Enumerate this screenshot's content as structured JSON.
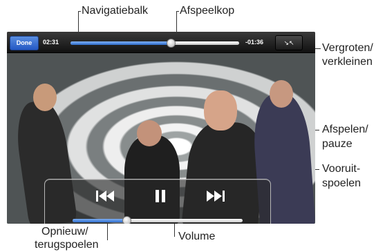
{
  "player": {
    "done_label": "Done",
    "elapsed": "02:31",
    "remaining": "-01:36",
    "playback_progress": 0.6,
    "volume_level": 0.32,
    "zoom_icon": "scale-arrows-icon",
    "controls": {
      "prev_icon": "rewind-icon",
      "pause_icon": "pause-icon",
      "next_icon": "fast-forward-icon"
    },
    "accent_color": "#2f6fcf"
  },
  "callouts": {
    "scrubber_bar": "Navigatiebalk",
    "playhead": "Afspeelkop",
    "scale_1": "Vergroten/",
    "scale_2": "verkleinen",
    "play_pause_1": "Afspelen/",
    "play_pause_2": "pauze",
    "next_1": "Vooruit-",
    "next_2": "spoelen",
    "previous_1": "Opnieuw/",
    "previous_2": "terugspoelen",
    "volume": "Volume"
  }
}
